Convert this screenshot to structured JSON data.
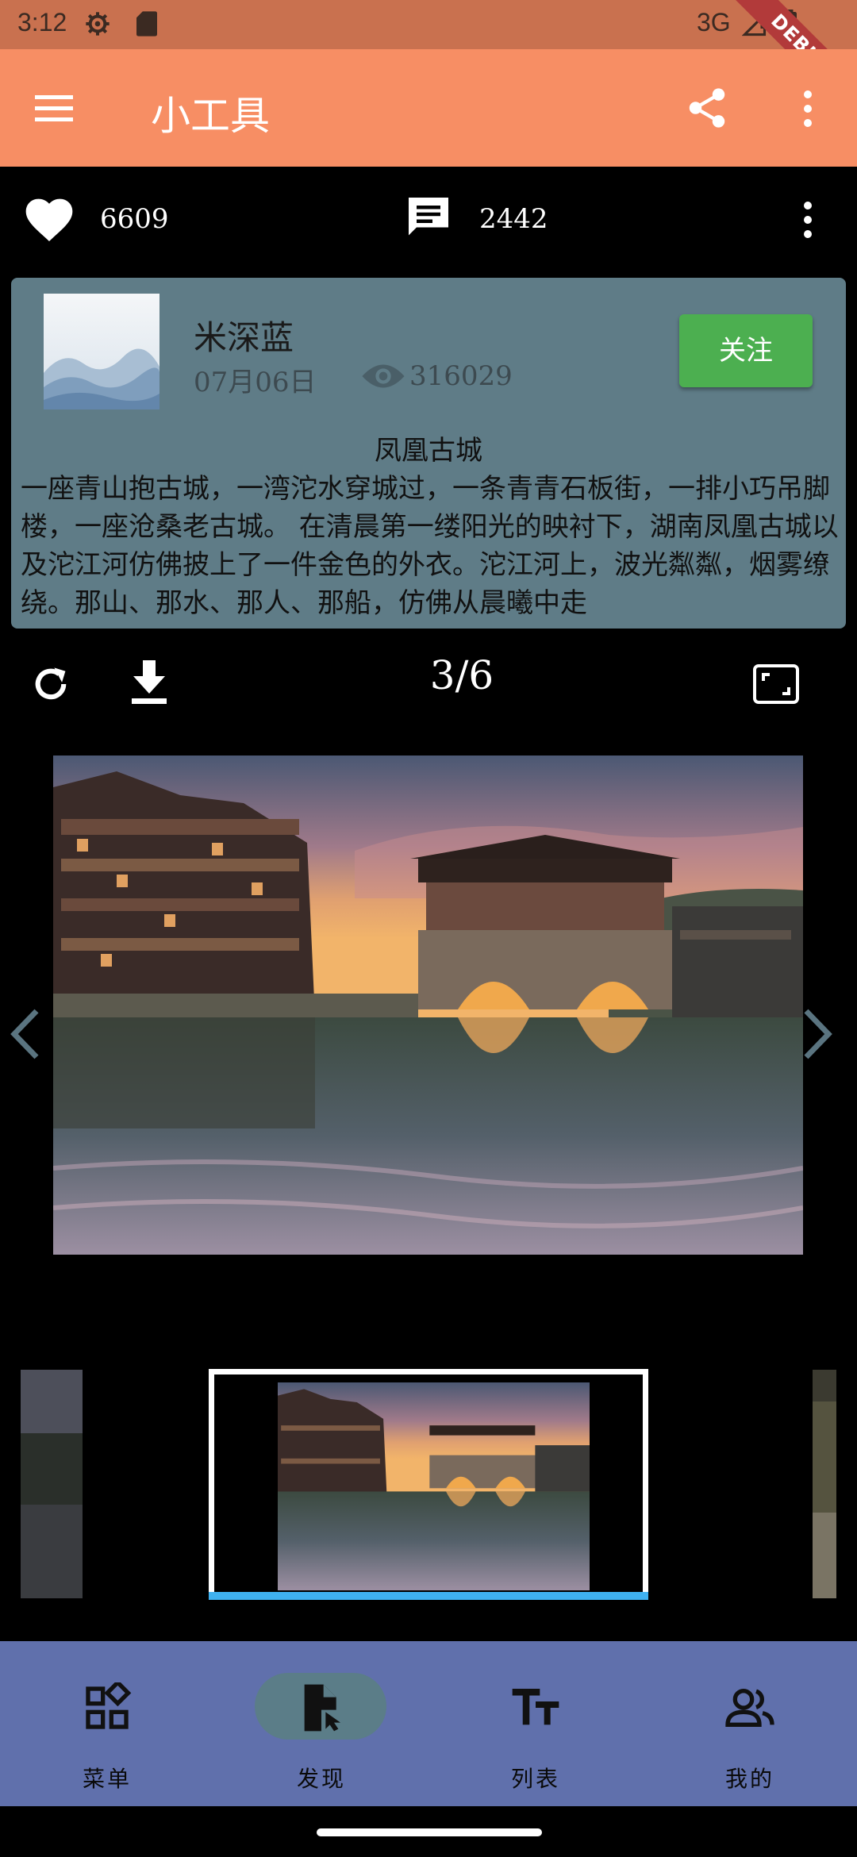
{
  "status_bar": {
    "time": "3:12",
    "network": "3G",
    "debug_label": "DEBUG",
    "background": "#c9714f"
  },
  "app_bar": {
    "title": "小工具",
    "background": "#f78e64"
  },
  "stats": {
    "likes": "6609",
    "comments": "2442"
  },
  "post": {
    "author": "米深蓝",
    "date": "07月06日",
    "views": "316029",
    "follow_label": "关注",
    "title": "凤凰古城",
    "body": "一座青山抱古城，一湾沱水穿城过，一条青青石板街，一排小巧吊脚楼，一座沧桑老古城。 在清晨第一缕阳光的映衬下，湖南凤凰古城以及沱江河仿佛披上了一件金色的外衣。沱江河上，波光粼粼，烟雾缭绕。那山、那水、那人、那船，仿佛从晨曦中走"
  },
  "viewer": {
    "page_indicator": "3/6"
  },
  "bottom_nav": {
    "items": [
      {
        "label": "菜单",
        "icon": "widgets-icon"
      },
      {
        "label": "发现",
        "icon": "document-cursor-icon",
        "active": true
      },
      {
        "label": "列表",
        "icon": "text-fields-icon"
      },
      {
        "label": "我的",
        "icon": "people-icon"
      }
    ],
    "background": "#6070ac",
    "active_pill": "#5b7d88"
  },
  "colors": {
    "follow": "#4caf50",
    "card": "#5f7c87",
    "thumb_indicator": "#3fb1f0"
  }
}
